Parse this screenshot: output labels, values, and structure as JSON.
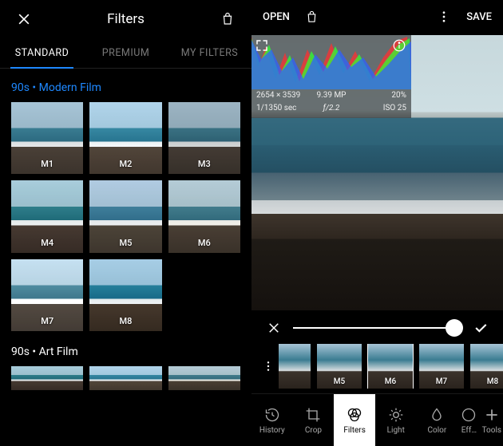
{
  "left": {
    "title": "Filters",
    "tabs": [
      "STANDARD",
      "PREMIUM",
      "MY FILTERS"
    ],
    "active_tab": 0,
    "section1_title": "90s • Modern Film",
    "section1": [
      "M1",
      "M2",
      "M3",
      "M4",
      "M5",
      "M6",
      "M7",
      "M8"
    ],
    "section2_title": "90s • Art Film"
  },
  "right": {
    "open": "OPEN",
    "save": "SAVE",
    "histogram": {
      "dims": "2654 × 3539",
      "mp": "9.39 MP",
      "pct": "20%",
      "shutter": "1/1350 sec",
      "aperture": "ƒ/2.2",
      "iso": "ISO 25"
    },
    "strip": [
      "M5",
      "M6",
      "M7",
      "M8"
    ],
    "strip_selected": 1,
    "tools": [
      "History",
      "Crop",
      "Filters",
      "Light",
      "Color",
      "Eff…",
      "Tools"
    ],
    "active_tool": 2
  }
}
